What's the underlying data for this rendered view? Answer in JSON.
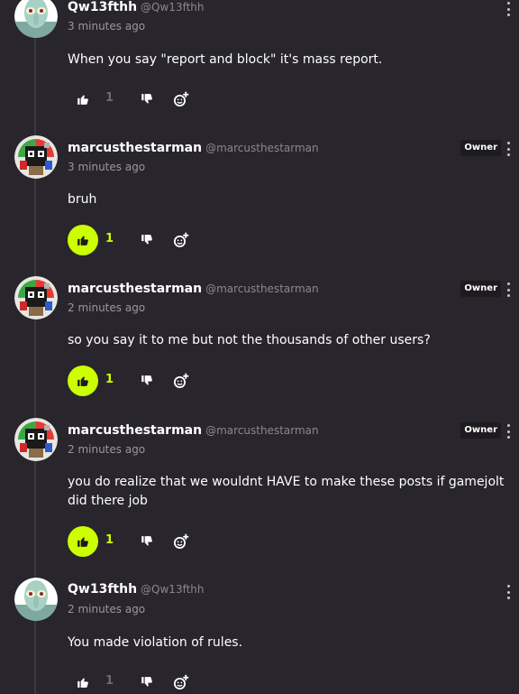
{
  "comments": [
    {
      "author": "Qw13fthh",
      "handle": "@Qw13fthh",
      "time": "3 minutes ago",
      "text": "When you say \"report and block\" it's mass report.",
      "likes": "1",
      "liked": false,
      "owner": false,
      "avatar_icon": "squidward-avatar-icon"
    },
    {
      "author": "marcusthestarman",
      "handle": "@marcusthestarman",
      "time": "3 minutes ago",
      "text": "bruh",
      "likes": "1",
      "liked": true,
      "owner": true,
      "owner_label": "Owner",
      "avatar_icon": "pixel-character-avatar-icon"
    },
    {
      "author": "marcusthestarman",
      "handle": "@marcusthestarman",
      "time": "2 minutes ago",
      "text": "so you say it to me but not the thousands of other users?",
      "likes": "1",
      "liked": true,
      "owner": true,
      "owner_label": "Owner",
      "avatar_icon": "pixel-character-avatar-icon"
    },
    {
      "author": "marcusthestarman",
      "handle": "@marcusthestarman",
      "time": "2 minutes ago",
      "text": "you do realize that we wouldnt HAVE to make these posts if gamejolt did there job",
      "likes": "1",
      "liked": true,
      "owner": true,
      "owner_label": "Owner",
      "avatar_icon": "pixel-character-avatar-icon"
    },
    {
      "author": "Qw13fthh",
      "handle": "@Qw13fthh",
      "time": "2 minutes ago",
      "text": "You made violation of rules.",
      "likes": "1",
      "liked": false,
      "owner": false,
      "avatar_icon": "squidward-avatar-icon"
    }
  ],
  "colors": {
    "background": "#28252c",
    "accent": "#ccff00",
    "muted_text": "#9a96a0"
  }
}
